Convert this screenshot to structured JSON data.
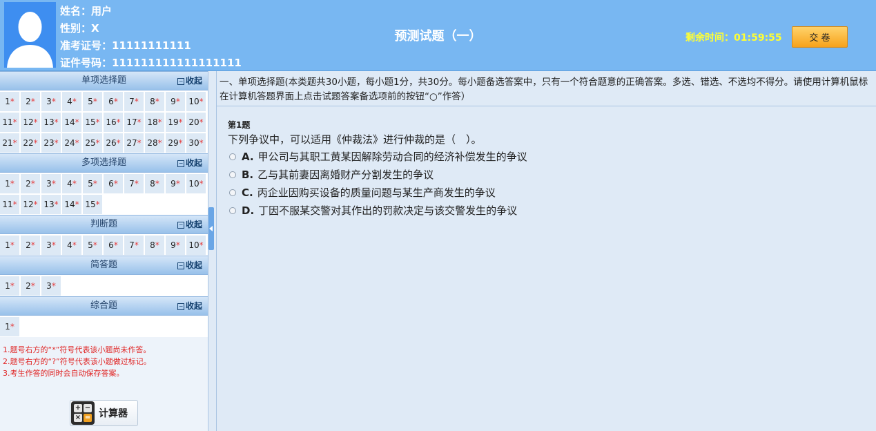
{
  "header": {
    "name_line": "姓名：用户",
    "gender_line": "性别：X",
    "admission_line": "准考证号：11111111111",
    "id_line": "证件号码：111111111111111111",
    "title": "预测试题（一）",
    "timer_label": "剩余时间：",
    "timer_value": "01:59:55",
    "submit_label": "交 卷",
    "colors": {
      "header_bg": "#78b7f2",
      "timer": "#ffff33",
      "submit": "#f7a21b"
    }
  },
  "sidebar": {
    "collapse_label": "收起",
    "sections": [
      {
        "title": "单项选择题",
        "rows": [
          [
            "1",
            "2",
            "3",
            "4",
            "5",
            "6",
            "7",
            "8",
            "9",
            "10"
          ],
          [
            "11",
            "12",
            "13",
            "14",
            "15",
            "16",
            "17",
            "18",
            "19",
            "20"
          ],
          [
            "21",
            "22",
            "23",
            "24",
            "25",
            "26",
            "27",
            "28",
            "29",
            "30"
          ]
        ]
      },
      {
        "title": "多项选择题",
        "rows": [
          [
            "1",
            "2",
            "3",
            "4",
            "5",
            "6",
            "7",
            "8",
            "9",
            "10"
          ],
          [
            "11",
            "12",
            "13",
            "14",
            "15"
          ]
        ]
      },
      {
        "title": "判断题",
        "rows": [
          [
            "1",
            "2",
            "3",
            "4",
            "5",
            "6",
            "7",
            "8",
            "9",
            "10"
          ]
        ]
      },
      {
        "title": "简答题",
        "rows": [
          [
            "1",
            "2",
            "3"
          ]
        ]
      },
      {
        "title": "综合题",
        "rows": [
          [
            "1"
          ]
        ]
      }
    ],
    "unanswered_mark": "*",
    "notes": [
      "1.题号右方的“*”符号代表该小题尚未作答。",
      "2.题号右方的“?”符号代表该小题做过标记。",
      "3.考生作答的同时会自动保存答案。"
    ],
    "calculator_label": "计算器",
    "calc_keys": [
      "+",
      "−",
      "×",
      "="
    ]
  },
  "main": {
    "instructions": "一、单项选择题(本类题共30小题，每小题1分，共30分。每小题备选答案中，只有一个符合题意的正确答案。多选、错选、不选均不得分。请使用计算机鼠标在计算机答题界面上点击试题答案备选项前的按钮“○”作答）",
    "question_number": "第1题",
    "question_text": "下列争议中，可以适用《仲裁法》进行仲裁的是（　）。",
    "options": [
      {
        "letter": "A.",
        "text": "甲公司与其职工黄某因解除劳动合同的经济补偿发生的争议"
      },
      {
        "letter": "B.",
        "text": "乙与其前妻因离婚财产分割发生的争议"
      },
      {
        "letter": "C.",
        "text": "丙企业因购买设备的质量问题与某生产商发生的争议"
      },
      {
        "letter": "D.",
        "text": "丁因不服某交警对其作出的罚款决定与该交警发生的争议"
      }
    ]
  }
}
